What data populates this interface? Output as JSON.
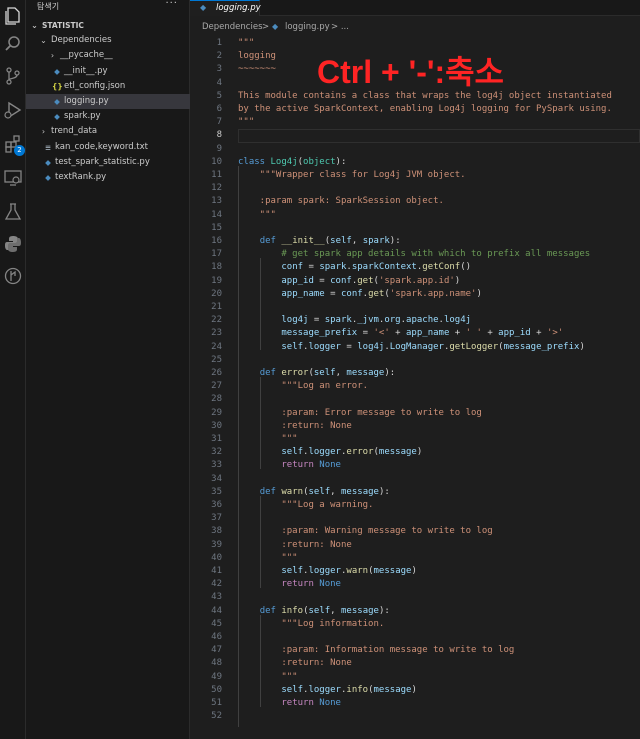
{
  "sidebar": {
    "title": "탐색기",
    "more": "···",
    "tree": [
      {
        "label": "STATISTIC",
        "chev": "⌄",
        "icon": "",
        "indent": 0,
        "root": true
      },
      {
        "label": "Dependencies",
        "chev": "⌄",
        "icon": "",
        "indent": 1
      },
      {
        "label": "__pycache__",
        "chev": "›",
        "icon": "",
        "indent": 2
      },
      {
        "label": "__init__.py",
        "chev": "",
        "icon": "py",
        "indent": 2
      },
      {
        "label": "etl_config.json",
        "chev": "",
        "icon": "json",
        "indent": 2
      },
      {
        "label": "logging.py",
        "chev": "",
        "icon": "py",
        "indent": 2,
        "selected": true
      },
      {
        "label": "spark.py",
        "chev": "",
        "icon": "py",
        "indent": 2
      },
      {
        "label": "trend_data",
        "chev": "›",
        "icon": "",
        "indent": 1
      },
      {
        "label": "kan_code,keyword.txt",
        "chev": "",
        "icon": "txt",
        "indent": 1
      },
      {
        "label": "test_spark_statistic.py",
        "chev": "",
        "icon": "py",
        "indent": 1
      },
      {
        "label": "textRank.py",
        "chev": "",
        "icon": "py",
        "indent": 1
      }
    ]
  },
  "tab": {
    "label": "logging.py",
    "icon": "python-file-icon"
  },
  "breadcrumb": {
    "folder": "Dependencies",
    "sep": ">",
    "file": "logging.py",
    "more": "> ..."
  },
  "annotation": "Ctrl + '-':축소",
  "icon_glyphs": {
    "py": "🐍",
    "json": "{}",
    "txt": "≡"
  },
  "editor": {
    "active_line": 8,
    "lines": [
      [
        [
          "\"\"\"",
          "str"
        ]
      ],
      [
        [
          "logging",
          "str"
        ]
      ],
      [
        [
          "~~~~~~~",
          "str"
        ]
      ],
      [],
      [
        [
          "This module contains a class that wraps the log4j object instantiated",
          "str"
        ]
      ],
      [
        [
          "by the active SparkContext, enabling Log4j logging for PySpark using.",
          "str"
        ]
      ],
      [
        [
          "\"\"\"",
          "str"
        ]
      ],
      [],
      [],
      [
        [
          "class ",
          "kw"
        ],
        [
          "Log4j",
          "cls"
        ],
        [
          "(",
          "pl"
        ],
        [
          "object",
          "cls"
        ],
        [
          "):",
          "pl"
        ]
      ],
      [
        [
          "    \"\"\"Wrapper class for Log4j JVM object.",
          "str"
        ]
      ],
      [],
      [
        [
          "    :param spark: SparkSession object.",
          "str"
        ]
      ],
      [
        [
          "    \"\"\"",
          "str"
        ]
      ],
      [],
      [
        [
          "    ",
          "pl"
        ],
        [
          "def ",
          "kw"
        ],
        [
          "__init__",
          "fn"
        ],
        [
          "(",
          "pl"
        ],
        [
          "self",
          "var"
        ],
        [
          ", ",
          "pl"
        ],
        [
          "spark",
          "var"
        ],
        [
          "):",
          "pl"
        ]
      ],
      [
        [
          "        # get spark app details with which to prefix all messages",
          "com"
        ]
      ],
      [
        [
          "        ",
          "pl"
        ],
        [
          "conf",
          "var"
        ],
        [
          " = ",
          "pl"
        ],
        [
          "spark",
          "var"
        ],
        [
          ".",
          "pl"
        ],
        [
          "sparkContext",
          "var"
        ],
        [
          ".",
          "pl"
        ],
        [
          "getConf",
          "fn"
        ],
        [
          "()",
          "pl"
        ]
      ],
      [
        [
          "        ",
          "pl"
        ],
        [
          "app_id",
          "var"
        ],
        [
          " = ",
          "pl"
        ],
        [
          "conf",
          "var"
        ],
        [
          ".",
          "pl"
        ],
        [
          "get",
          "fn"
        ],
        [
          "(",
          "pl"
        ],
        [
          "'spark.app.id'",
          "str"
        ],
        [
          ")",
          "pl"
        ]
      ],
      [
        [
          "        ",
          "pl"
        ],
        [
          "app_name",
          "var"
        ],
        [
          " = ",
          "pl"
        ],
        [
          "conf",
          "var"
        ],
        [
          ".",
          "pl"
        ],
        [
          "get",
          "fn"
        ],
        [
          "(",
          "pl"
        ],
        [
          "'spark.app.name'",
          "str"
        ],
        [
          ")",
          "pl"
        ]
      ],
      [],
      [
        [
          "        ",
          "pl"
        ],
        [
          "log4j",
          "var"
        ],
        [
          " = ",
          "pl"
        ],
        [
          "spark",
          "var"
        ],
        [
          ".",
          "pl"
        ],
        [
          "_jvm",
          "var"
        ],
        [
          ".",
          "pl"
        ],
        [
          "org",
          "var"
        ],
        [
          ".",
          "pl"
        ],
        [
          "apache",
          "var"
        ],
        [
          ".",
          "pl"
        ],
        [
          "log4j",
          "var"
        ]
      ],
      [
        [
          "        ",
          "pl"
        ],
        [
          "message_prefix",
          "var"
        ],
        [
          " = ",
          "pl"
        ],
        [
          "'<'",
          "str"
        ],
        [
          " + ",
          "pl"
        ],
        [
          "app_name",
          "var"
        ],
        [
          " + ",
          "pl"
        ],
        [
          "' '",
          "str"
        ],
        [
          " + ",
          "pl"
        ],
        [
          "app_id",
          "var"
        ],
        [
          " + ",
          "pl"
        ],
        [
          "'>'",
          "str"
        ]
      ],
      [
        [
          "        ",
          "pl"
        ],
        [
          "self",
          "var"
        ],
        [
          ".",
          "pl"
        ],
        [
          "logger",
          "var"
        ],
        [
          " = ",
          "pl"
        ],
        [
          "log4j",
          "var"
        ],
        [
          ".",
          "pl"
        ],
        [
          "LogManager",
          "var"
        ],
        [
          ".",
          "pl"
        ],
        [
          "getLogger",
          "fn"
        ],
        [
          "(",
          "pl"
        ],
        [
          "message_prefix",
          "var"
        ],
        [
          ")",
          "pl"
        ]
      ],
      [],
      [
        [
          "    ",
          "pl"
        ],
        [
          "def ",
          "kw"
        ],
        [
          "error",
          "fn"
        ],
        [
          "(",
          "pl"
        ],
        [
          "self",
          "var"
        ],
        [
          ", ",
          "pl"
        ],
        [
          "message",
          "var"
        ],
        [
          "):",
          "pl"
        ]
      ],
      [
        [
          "        \"\"\"Log an error.",
          "str"
        ]
      ],
      [],
      [
        [
          "        :param: Error message to write to log",
          "str"
        ]
      ],
      [
        [
          "        :return: None",
          "str"
        ]
      ],
      [
        [
          "        \"\"\"",
          "str"
        ]
      ],
      [
        [
          "        ",
          "pl"
        ],
        [
          "self",
          "var"
        ],
        [
          ".",
          "pl"
        ],
        [
          "logger",
          "var"
        ],
        [
          ".",
          "pl"
        ],
        [
          "error",
          "fn"
        ],
        [
          "(",
          "pl"
        ],
        [
          "message",
          "var"
        ],
        [
          ")",
          "pl"
        ]
      ],
      [
        [
          "        ",
          "pl"
        ],
        [
          "return ",
          "ctl"
        ],
        [
          "None",
          "kw"
        ]
      ],
      [],
      [
        [
          "    ",
          "pl"
        ],
        [
          "def ",
          "kw"
        ],
        [
          "warn",
          "fn"
        ],
        [
          "(",
          "pl"
        ],
        [
          "self",
          "var"
        ],
        [
          ", ",
          "pl"
        ],
        [
          "message",
          "var"
        ],
        [
          "):",
          "pl"
        ]
      ],
      [
        [
          "        \"\"\"Log a warning.",
          "str"
        ]
      ],
      [],
      [
        [
          "        :param: Warning message to write to log",
          "str"
        ]
      ],
      [
        [
          "        :return: None",
          "str"
        ]
      ],
      [
        [
          "        \"\"\"",
          "str"
        ]
      ],
      [
        [
          "        ",
          "pl"
        ],
        [
          "self",
          "var"
        ],
        [
          ".",
          "pl"
        ],
        [
          "logger",
          "var"
        ],
        [
          ".",
          "pl"
        ],
        [
          "warn",
          "fn"
        ],
        [
          "(",
          "pl"
        ],
        [
          "message",
          "var"
        ],
        [
          ")",
          "pl"
        ]
      ],
      [
        [
          "        ",
          "pl"
        ],
        [
          "return ",
          "ctl"
        ],
        [
          "None",
          "kw"
        ]
      ],
      [],
      [
        [
          "    ",
          "pl"
        ],
        [
          "def ",
          "kw"
        ],
        [
          "info",
          "fn"
        ],
        [
          "(",
          "pl"
        ],
        [
          "self",
          "var"
        ],
        [
          ", ",
          "pl"
        ],
        [
          "message",
          "var"
        ],
        [
          "):",
          "pl"
        ]
      ],
      [
        [
          "        \"\"\"Log information.",
          "str"
        ]
      ],
      [],
      [
        [
          "        :param: Information message to write to log",
          "str"
        ]
      ],
      [
        [
          "        :return: None",
          "str"
        ]
      ],
      [
        [
          "        \"\"\"",
          "str"
        ]
      ],
      [
        [
          "        ",
          "pl"
        ],
        [
          "self",
          "var"
        ],
        [
          ".",
          "pl"
        ],
        [
          "logger",
          "var"
        ],
        [
          ".",
          "pl"
        ],
        [
          "info",
          "fn"
        ],
        [
          "(",
          "pl"
        ],
        [
          "message",
          "var"
        ],
        [
          ")",
          "pl"
        ]
      ],
      [
        [
          "        ",
          "pl"
        ],
        [
          "return ",
          "ctl"
        ],
        [
          "None",
          "kw"
        ]
      ],
      []
    ]
  }
}
